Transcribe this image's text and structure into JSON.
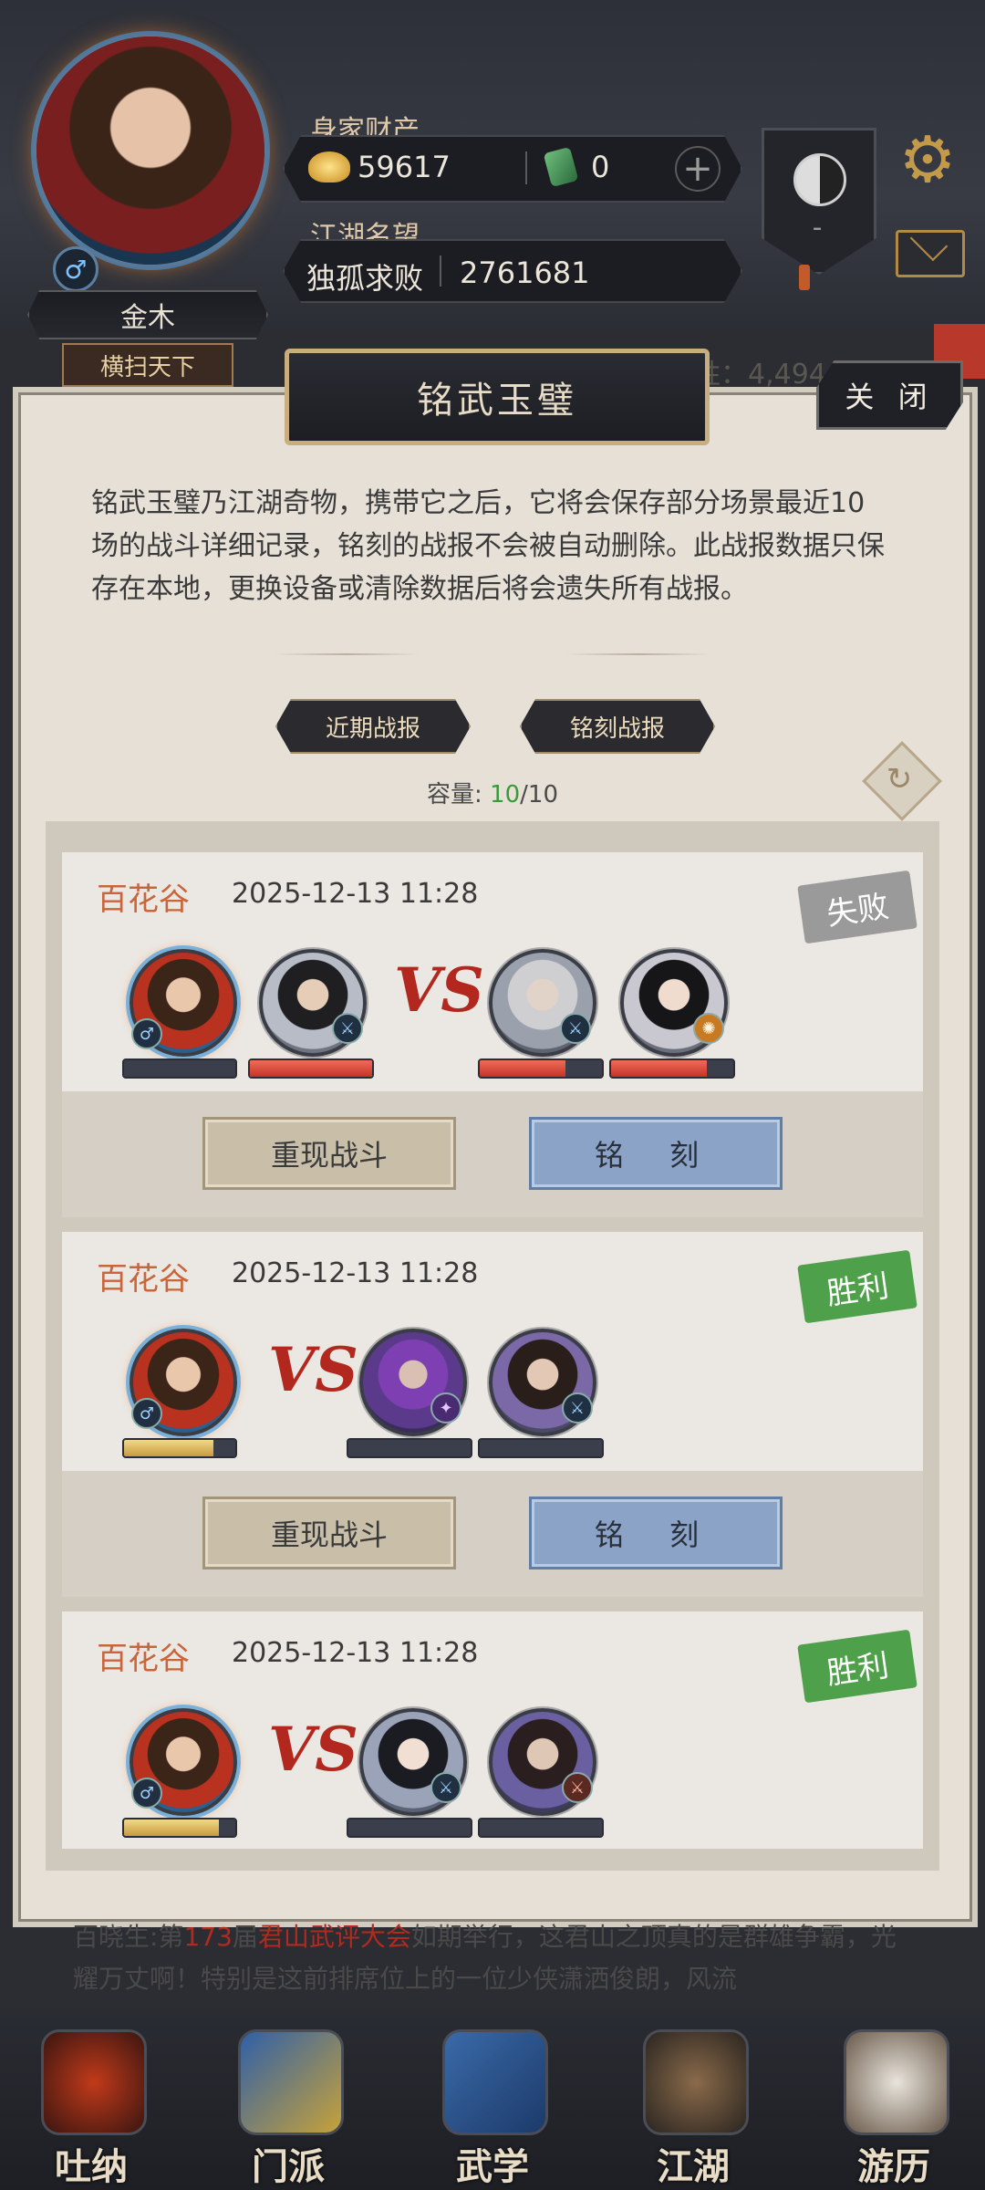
{
  "player": {
    "name": "金木",
    "title": "横扫天下",
    "gender_symbol": "♂"
  },
  "header": {
    "wealth_label": "身家财产",
    "gold": "59617",
    "jade": "0",
    "plus": "+",
    "reputation_label": "江湖名望",
    "reputation_title": "独孤求败",
    "reputation_value": "2761681",
    "emblem_text": "-",
    "background_stat": "胜：4,494"
  },
  "modal": {
    "title": "铭武玉璧",
    "close_label": "关 闭",
    "description": "铭武玉璧乃江湖奇物，携带它之后，它将会保存部分场景最近10场的战斗详细记录，铭刻的战报不会被自动删除。此战报数据只保存在本地，更换设备或清除数据后将会遗失所有战报。",
    "tabs": [
      "近期战报",
      "铭刻战报"
    ],
    "capacity_label": "容量:",
    "capacity_current": "10",
    "capacity_max": "/10"
  },
  "records": [
    {
      "location": "百花谷",
      "time": "2025-12-13 11:28",
      "result": "失败",
      "vs": "VS",
      "replay_label": "重现战斗",
      "engrave_label": "铭 刻",
      "allies_hp": [
        0.0,
        1.0
      ],
      "enemies_hp": [
        0.7,
        0.78
      ]
    },
    {
      "location": "百花谷",
      "time": "2025-12-13 11:28",
      "result": "胜利",
      "vs": "VS",
      "replay_label": "重现战斗",
      "engrave_label": "铭 刻",
      "allies_hp": [
        0.8
      ],
      "enemies_hp": [
        0.0,
        0.0
      ]
    },
    {
      "location": "百花谷",
      "time": "2025-12-13 11:28",
      "result": "胜利",
      "vs": "VS",
      "allies_hp": [
        0.85
      ],
      "enemies_hp": [
        0.0,
        0.0
      ]
    }
  ],
  "news": {
    "prefix": "百晓生:第",
    "number": "173",
    "mid": "届",
    "event": "君山武评大会",
    "rest": "如期举行，这君山之顶真的是群雄争霸，光耀万丈啊！特别是这前排席位上的一位少侠潇洒俊朗，风流"
  },
  "bottom_nav": [
    "吐纳",
    "门派",
    "武学",
    "江湖",
    "游历"
  ],
  "colors": {
    "accent_location": "#c8653a",
    "win_stamp": "#4fa04a",
    "lose_stamp": "#9a9a9a",
    "vs": "#b2281f"
  }
}
